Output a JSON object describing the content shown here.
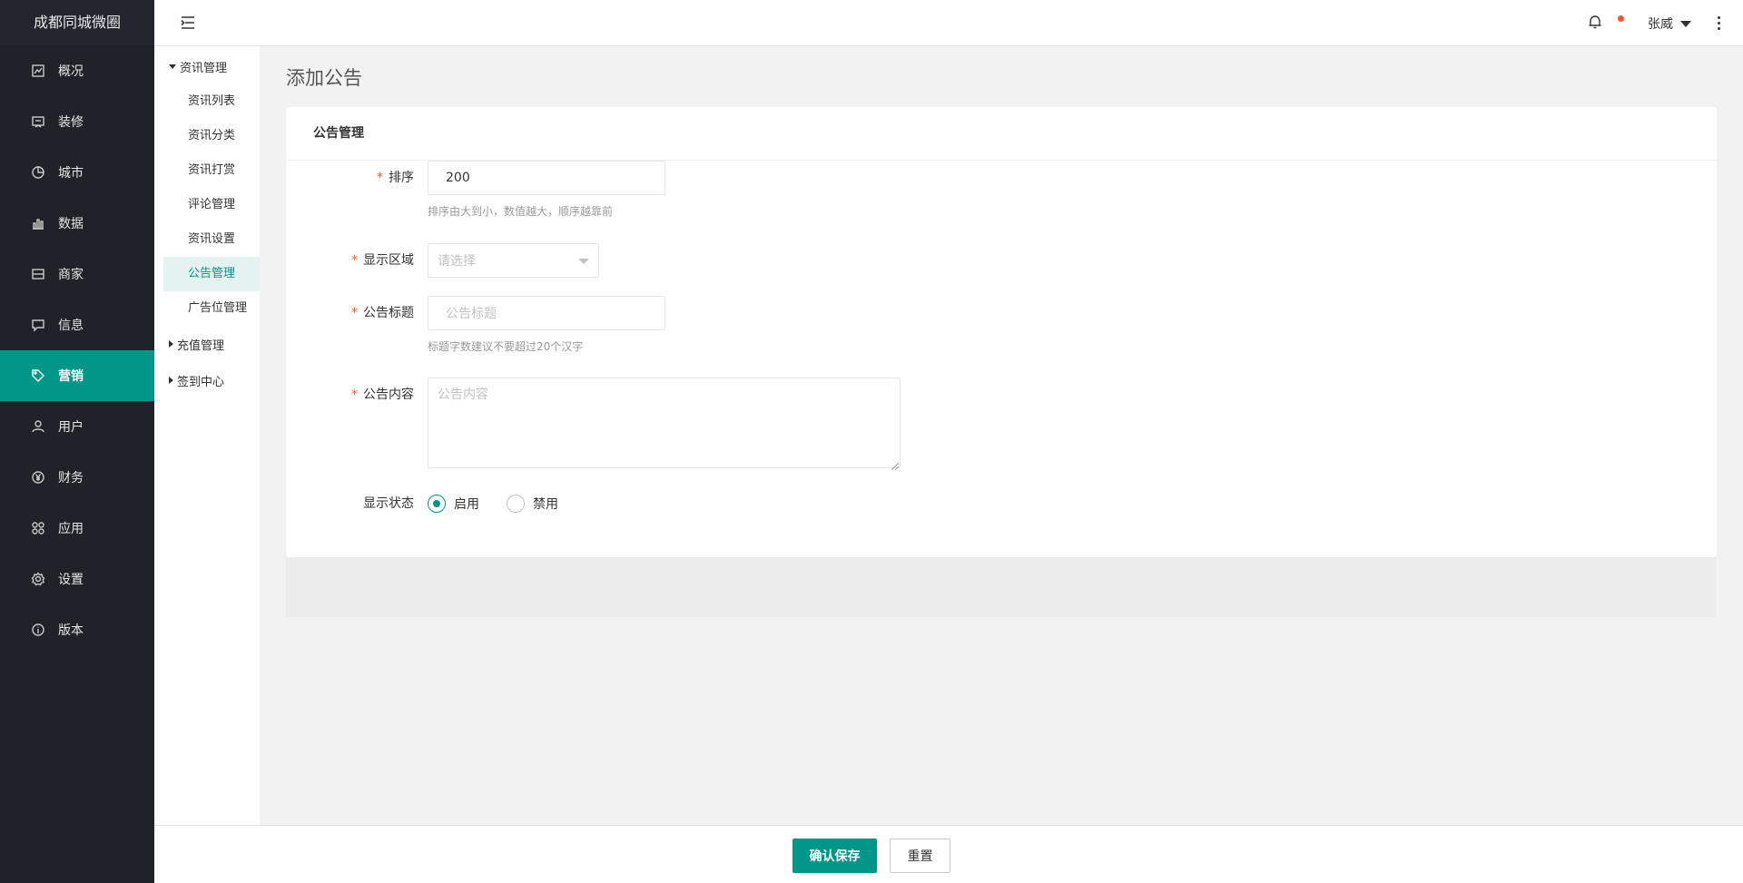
{
  "app": {
    "brand": "成都同城微圈"
  },
  "sidebar": {
    "items": [
      {
        "label": "概况",
        "icon": "overview-icon"
      },
      {
        "label": "装修",
        "icon": "decorate-icon"
      },
      {
        "label": "城市",
        "icon": "city-icon"
      },
      {
        "label": "数据",
        "icon": "chart-icon"
      },
      {
        "label": "商家",
        "icon": "store-icon"
      },
      {
        "label": "信息",
        "icon": "message-icon"
      },
      {
        "label": "营销",
        "icon": "tag-icon",
        "active": true
      },
      {
        "label": "用户",
        "icon": "user-icon"
      },
      {
        "label": "财务",
        "icon": "yen-icon"
      },
      {
        "label": "应用",
        "icon": "apps-icon"
      },
      {
        "label": "设置",
        "icon": "gear-icon"
      },
      {
        "label": "版本",
        "icon": "info-icon"
      }
    ]
  },
  "header": {
    "user_name": "张威"
  },
  "subnav": {
    "group1": "资讯管理",
    "items": [
      "资讯列表",
      "资讯分类",
      "资讯打赏",
      "评论管理",
      "资讯设置",
      "公告管理",
      "广告位管理"
    ],
    "active": "公告管理",
    "group2": "充值管理",
    "group3": "签到中心"
  },
  "main": {
    "page_title": "添加公告",
    "card_title": "公告管理",
    "form": {
      "sort_label": "排序",
      "sort_value": "200",
      "sort_hint": "排序由大到小，数值越大，顺序越靠前",
      "area_label": "显示区域",
      "area_placeholder": "请选择",
      "title_label": "公告标题",
      "title_placeholder": "公告标题",
      "title_hint": "标题字数建议不要超过20个汉字",
      "content_label": "公告内容",
      "content_placeholder": "公告内容",
      "status_label": "显示状态",
      "status_on": "启用",
      "status_off": "禁用",
      "status_selected": "启用"
    }
  },
  "footer": {
    "save_label": "确认保存",
    "reset_label": "重置"
  },
  "colors": {
    "accent": "#009688",
    "sidebar_bg": "#20222a",
    "required": "#ff5722"
  }
}
